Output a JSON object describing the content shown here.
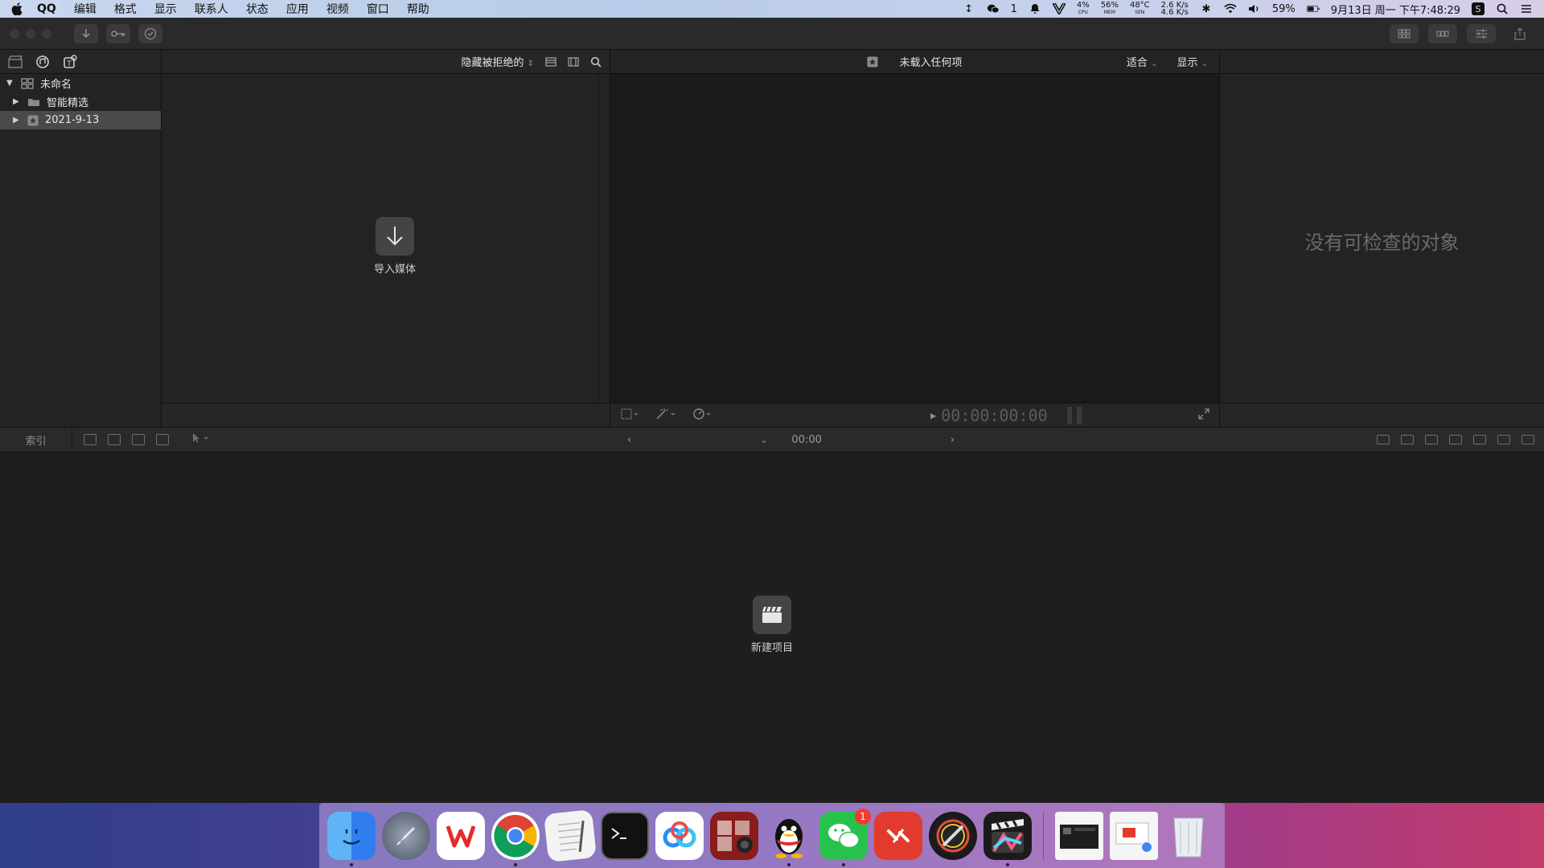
{
  "menubar": {
    "app_name": "QQ",
    "items": [
      "编辑",
      "格式",
      "显示",
      "联系人",
      "状态",
      "应用",
      "视频",
      "窗口",
      "帮助"
    ],
    "wechat_count": "1",
    "cpu": {
      "value": "4%",
      "label": "CPU"
    },
    "mem": {
      "value": "56%",
      "label": "MEM"
    },
    "sen": {
      "value": "48°C",
      "label": "SEN"
    },
    "net": {
      "up": "2.6 K/s",
      "down": "4.6 K/s"
    },
    "battery": "59%",
    "datetime": "9月13日 周一 下午7:48:29"
  },
  "browser": {
    "filter_label": "隐藏被拒绝的",
    "import_label": "导入媒体"
  },
  "library": {
    "items": [
      {
        "label": "未命名",
        "level": 0,
        "expanded": true
      },
      {
        "label": "智能精选",
        "level": 1,
        "expanded": false
      },
      {
        "label": "2021-9-13",
        "level": 1,
        "expanded": false,
        "selected": true
      }
    ]
  },
  "viewer": {
    "title": "未载入任何项",
    "fit_label": "适合",
    "display_label": "显示",
    "timecode": "00:00:00:00"
  },
  "inspector": {
    "empty_message": "没有可检查的对象"
  },
  "timeline": {
    "index_label": "索引",
    "time": "00:00",
    "new_project_label": "新建项目"
  },
  "dock": {
    "apps": [
      "finder",
      "launchpad",
      "wps",
      "chrome",
      "textedit",
      "terminal",
      "baidu-netdisk",
      "photo-booth",
      "qq",
      "wechat",
      "remote-desktop",
      "pixelmator",
      "final-cut-pro"
    ],
    "wechat_badge": "1"
  },
  "colors": {
    "accent_red": "#f23b30",
    "panel_bg": "#232323",
    "viewer_bg": "#1a1a1a"
  }
}
